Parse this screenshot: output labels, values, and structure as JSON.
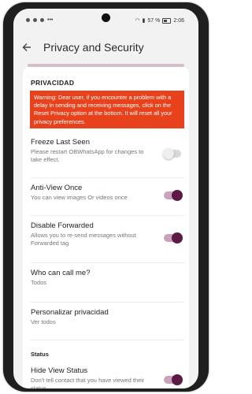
{
  "statusbar": {
    "left_icons": [
      "whatsapp-icon",
      "instagram-icon",
      "settings-icon",
      "more-dots-icon"
    ],
    "battery_text": "57 %",
    "time": "2:06"
  },
  "appbar": {
    "title": "Privacy and Security",
    "back_icon": "arrow-back-icon"
  },
  "colors": {
    "warning_bg": "#e8421c",
    "toggle_on": "#5c1a45",
    "toggle_track_on": "#c9a3b9"
  },
  "section_privacidad": "PRIVACIDAD",
  "warning_text": "Warning: Dear user, if you encounter a problem with a delay in sending and receiving messages, click on the Reset Privacy option at the bottom. It will reset all your privacy preferences.",
  "items": [
    {
      "label": "Freeze Last Seen",
      "sub": "Please restart OBWhatsApp for changes to take effect.",
      "toggle": false
    },
    {
      "label": "Anti-View Once",
      "sub": "You can view images Or videos once",
      "toggle": true
    },
    {
      "label": "Disable Forwarded",
      "sub": "Allows you to re-send messages without Forwarded tag",
      "toggle": true
    },
    {
      "label": "Who can call me?",
      "sub": "Todos"
    },
    {
      "label": "Personalizar privacidad",
      "sub": "Ver todos"
    }
  ],
  "section_status": "Status",
  "status_items": [
    {
      "label": "Hide View Status",
      "sub": "Don't tell contact that you have viewed their status.",
      "toggle": true
    }
  ]
}
